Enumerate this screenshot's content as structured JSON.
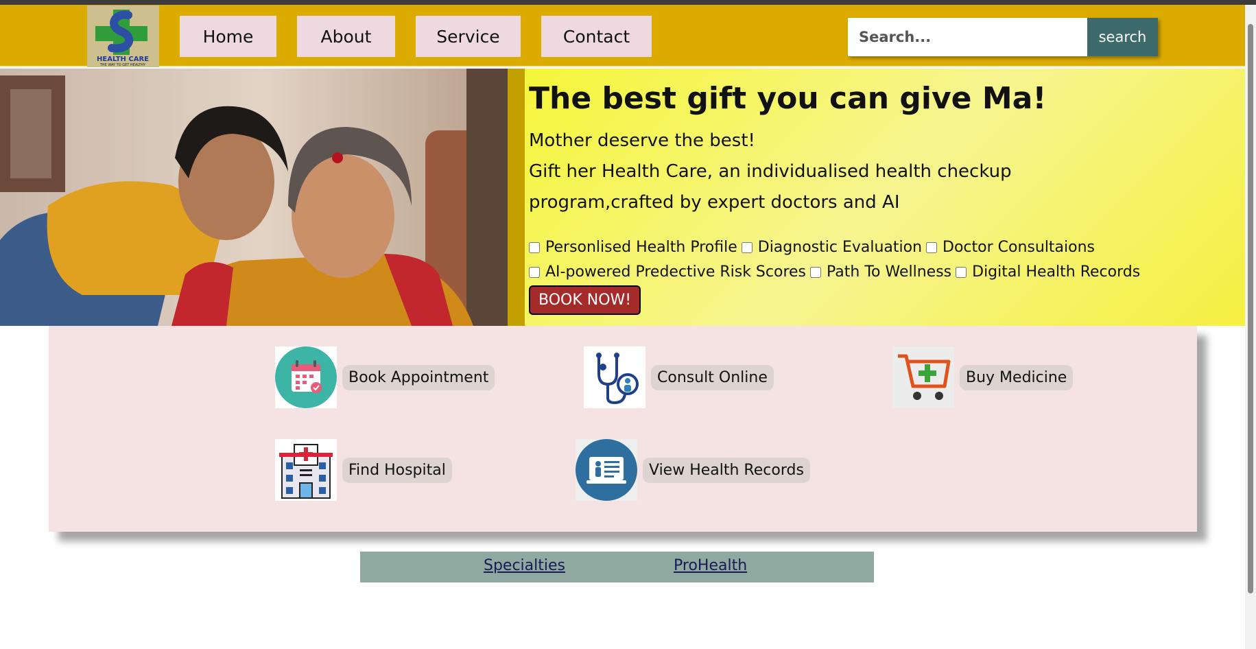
{
  "brand": {
    "logo_text": "HEALTH CARE",
    "logo_tagline": "THE WAY TO GET HEALTHY",
    "colors": {
      "nav_bg": "#dbab00",
      "hero_bg": "#f5f53a",
      "accent": "#3d6b6b",
      "book": "#a52a2a"
    }
  },
  "nav": {
    "items": [
      {
        "label": "Home"
      },
      {
        "label": "About"
      },
      {
        "label": "Service"
      },
      {
        "label": "Contact"
      }
    ]
  },
  "search": {
    "placeholder": "Search...",
    "value": "",
    "button_label": "search"
  },
  "hero": {
    "image_alt": "Daughter hugging her mother",
    "title": "The best gift you can give Ma!",
    "line1": "Mother deserve the best!",
    "line2": "Gift her Health Care, an individualised health checkup",
    "line3": "program,crafted by expert doctors and AI",
    "options": [
      {
        "label": "Personlised Health Profile",
        "checked": false
      },
      {
        "label": "Diagnostic Evaluation",
        "checked": false
      },
      {
        "label": "Doctor Consultaions",
        "checked": false
      },
      {
        "label": "AI-powered Predective Risk Scores",
        "checked": false
      },
      {
        "label": "Path To Wellness",
        "checked": false
      },
      {
        "label": "Digital Health Records",
        "checked": false
      }
    ],
    "book_button": "BOOK NOW!"
  },
  "services": {
    "items": [
      {
        "label": "Book Appointment",
        "icon": "calendar-icon"
      },
      {
        "label": "Consult Online",
        "icon": "stethoscope-icon"
      },
      {
        "label": "Buy Medicine",
        "icon": "cart-icon"
      },
      {
        "label": "Find Hospital",
        "icon": "hospital-icon"
      },
      {
        "label": "View Health Records",
        "icon": "health-record-icon"
      }
    ]
  },
  "footer": {
    "links": [
      {
        "label": "Specialties"
      },
      {
        "label": "ProHealth"
      }
    ]
  }
}
